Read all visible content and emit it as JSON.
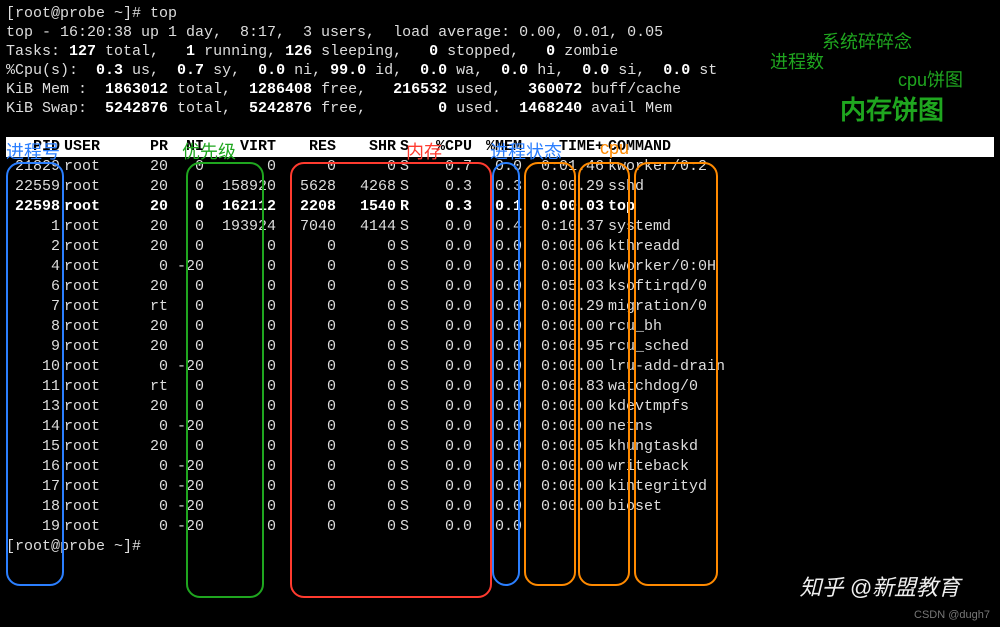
{
  "prompt1": "[root@probe ~]# top",
  "summary": {
    "line1_a": "top - 16:20:38 up 1 day,  8:17,  3 users,  load average: 0.00, 0.01, 0.05",
    "tasks_a": "Tasks: ",
    "tasks_total": "127 ",
    "tasks_b": "total,   ",
    "tasks_running": "1 ",
    "tasks_c": "running, ",
    "tasks_sleeping": "126 ",
    "tasks_d": "sleeping,   ",
    "tasks_stopped": "0 ",
    "tasks_e": "stopped,   ",
    "tasks_zombie": "0 ",
    "tasks_f": "zombie",
    "cpu_a": "%Cpu(s):  ",
    "cpu_us": "0.3 ",
    "cpu_b": "us,  ",
    "cpu_sy": "0.7 ",
    "cpu_c": "sy,  ",
    "cpu_ni": "0.0 ",
    "cpu_d": "ni, ",
    "cpu_id": "99.0 ",
    "cpu_e": "id,  ",
    "cpu_wa": "0.0 ",
    "cpu_f": "wa,  ",
    "cpu_hi": "0.0 ",
    "cpu_g": "hi,  ",
    "cpu_si": "0.0 ",
    "cpu_h": "si,  ",
    "cpu_st": "0.0 ",
    "cpu_i": "st",
    "mem_a": "KiB Mem : ",
    "mem_total": " 1863012 ",
    "mem_b": "total, ",
    "mem_free": " 1286408 ",
    "mem_c": "free,   ",
    "mem_used": "216532 ",
    "mem_d": "used,   ",
    "mem_buff": "360072 ",
    "mem_e": "buff/cache",
    "swap_a": "KiB Swap: ",
    "swap_total": " 5242876 ",
    "swap_b": "total, ",
    "swap_free": " 5242876 ",
    "swap_c": "free,        ",
    "swap_used": "0 ",
    "swap_d": "used. ",
    "swap_avail": " 1468240 ",
    "swap_e": "avail Mem"
  },
  "headers": {
    "pid": "PID",
    "user": "USER",
    "pr": "PR",
    "ni": "NI",
    "virt": "VIRT",
    "res": "RES",
    "shr": "SHR",
    "s": "S",
    "cpu": "%CPU",
    "mem": "%MEM",
    "time": "TIME+",
    "cmd": "COMMAND"
  },
  "rows": [
    {
      "pid": "21829",
      "user": "root",
      "pr": "20",
      "ni": "0",
      "virt": "0",
      "res": "0",
      "shr": "0",
      "s": "S",
      "cpu": "0.7",
      "mem": "0.0",
      "time": "0:01.46",
      "cmd": "kworker/0:2",
      "hl": false
    },
    {
      "pid": "22559",
      "user": "root",
      "pr": "20",
      "ni": "0",
      "virt": "158920",
      "res": "5628",
      "shr": "4268",
      "s": "S",
      "cpu": "0.3",
      "mem": "0.3",
      "time": "0:00.29",
      "cmd": "sshd",
      "hl": false
    },
    {
      "pid": "22598",
      "user": "root",
      "pr": "20",
      "ni": "0",
      "virt": "162112",
      "res": "2208",
      "shr": "1540",
      "s": "R",
      "cpu": "0.3",
      "mem": "0.1",
      "time": "0:00.03",
      "cmd": "top",
      "hl": true
    },
    {
      "pid": "1",
      "user": "root",
      "pr": "20",
      "ni": "0",
      "virt": "193924",
      "res": "7040",
      "shr": "4144",
      "s": "S",
      "cpu": "0.0",
      "mem": "0.4",
      "time": "0:10.37",
      "cmd": "systemd",
      "hl": false
    },
    {
      "pid": "2",
      "user": "root",
      "pr": "20",
      "ni": "0",
      "virt": "0",
      "res": "0",
      "shr": "0",
      "s": "S",
      "cpu": "0.0",
      "mem": "0.0",
      "time": "0:00.06",
      "cmd": "kthreadd",
      "hl": false
    },
    {
      "pid": "4",
      "user": "root",
      "pr": "0",
      "ni": "-20",
      "virt": "0",
      "res": "0",
      "shr": "0",
      "s": "S",
      "cpu": "0.0",
      "mem": "0.0",
      "time": "0:00.00",
      "cmd": "kworker/0:0H",
      "hl": false
    },
    {
      "pid": "6",
      "user": "root",
      "pr": "20",
      "ni": "0",
      "virt": "0",
      "res": "0",
      "shr": "0",
      "s": "S",
      "cpu": "0.0",
      "mem": "0.0",
      "time": "0:05.03",
      "cmd": "ksoftirqd/0",
      "hl": false
    },
    {
      "pid": "7",
      "user": "root",
      "pr": "rt",
      "ni": "0",
      "virt": "0",
      "res": "0",
      "shr": "0",
      "s": "S",
      "cpu": "0.0",
      "mem": "0.0",
      "time": "0:00.29",
      "cmd": "migration/0",
      "hl": false
    },
    {
      "pid": "8",
      "user": "root",
      "pr": "20",
      "ni": "0",
      "virt": "0",
      "res": "0",
      "shr": "0",
      "s": "S",
      "cpu": "0.0",
      "mem": "0.0",
      "time": "0:00.00",
      "cmd": "rcu_bh",
      "hl": false
    },
    {
      "pid": "9",
      "user": "root",
      "pr": "20",
      "ni": "0",
      "virt": "0",
      "res": "0",
      "shr": "0",
      "s": "S",
      "cpu": "0.0",
      "mem": "0.0",
      "time": "0:06.95",
      "cmd": "rcu_sched",
      "hl": false
    },
    {
      "pid": "10",
      "user": "root",
      "pr": "0",
      "ni": "-20",
      "virt": "0",
      "res": "0",
      "shr": "0",
      "s": "S",
      "cpu": "0.0",
      "mem": "0.0",
      "time": "0:00.00",
      "cmd": "lru-add-drain",
      "hl": false
    },
    {
      "pid": "11",
      "user": "root",
      "pr": "rt",
      "ni": "0",
      "virt": "0",
      "res": "0",
      "shr": "0",
      "s": "S",
      "cpu": "0.0",
      "mem": "0.0",
      "time": "0:06.83",
      "cmd": "watchdog/0",
      "hl": false
    },
    {
      "pid": "13",
      "user": "root",
      "pr": "20",
      "ni": "0",
      "virt": "0",
      "res": "0",
      "shr": "0",
      "s": "S",
      "cpu": "0.0",
      "mem": "0.0",
      "time": "0:00.00",
      "cmd": "kdevtmpfs",
      "hl": false
    },
    {
      "pid": "14",
      "user": "root",
      "pr": "0",
      "ni": "-20",
      "virt": "0",
      "res": "0",
      "shr": "0",
      "s": "S",
      "cpu": "0.0",
      "mem": "0.0",
      "time": "0:00.00",
      "cmd": "netns",
      "hl": false
    },
    {
      "pid": "15",
      "user": "root",
      "pr": "20",
      "ni": "0",
      "virt": "0",
      "res": "0",
      "shr": "0",
      "s": "S",
      "cpu": "0.0",
      "mem": "0.0",
      "time": "0:00.05",
      "cmd": "khungtaskd",
      "hl": false
    },
    {
      "pid": "16",
      "user": "root",
      "pr": "0",
      "ni": "-20",
      "virt": "0",
      "res": "0",
      "shr": "0",
      "s": "S",
      "cpu": "0.0",
      "mem": "0.0",
      "time": "0:00.00",
      "cmd": "writeback",
      "hl": false
    },
    {
      "pid": "17",
      "user": "root",
      "pr": "0",
      "ni": "-20",
      "virt": "0",
      "res": "0",
      "shr": "0",
      "s": "S",
      "cpu": "0.0",
      "mem": "0.0",
      "time": "0:00.00",
      "cmd": "kintegrityd",
      "hl": false
    },
    {
      "pid": "18",
      "user": "root",
      "pr": "0",
      "ni": "-20",
      "virt": "0",
      "res": "0",
      "shr": "0",
      "s": "S",
      "cpu": "0.0",
      "mem": "0.0",
      "time": "0:00.00",
      "cmd": "bioset",
      "hl": false
    },
    {
      "pid": "19",
      "user": "root",
      "pr": "0",
      "ni": "-20",
      "virt": "0",
      "res": "0",
      "shr": "0",
      "s": "S",
      "cpu": "0.0",
      "mem": "0.0",
      "time": "",
      "cmd": "",
      "hl": false
    }
  ],
  "prompt2": "[root@probe ~]#",
  "ann": {
    "pidlabel": "进程号",
    "priolabel": "优先级",
    "memlabel": "内存",
    "statelabel": "进程状态",
    "cpulabel": "cpu",
    "sysload": "系统碎碎念",
    "proccnt": "进程数",
    "cpupie": "cpu饼图",
    "mempie": "内存饼图",
    "watermark": "知乎 @新盟教育",
    "csdnsrc": "CSDN @dugh7"
  }
}
